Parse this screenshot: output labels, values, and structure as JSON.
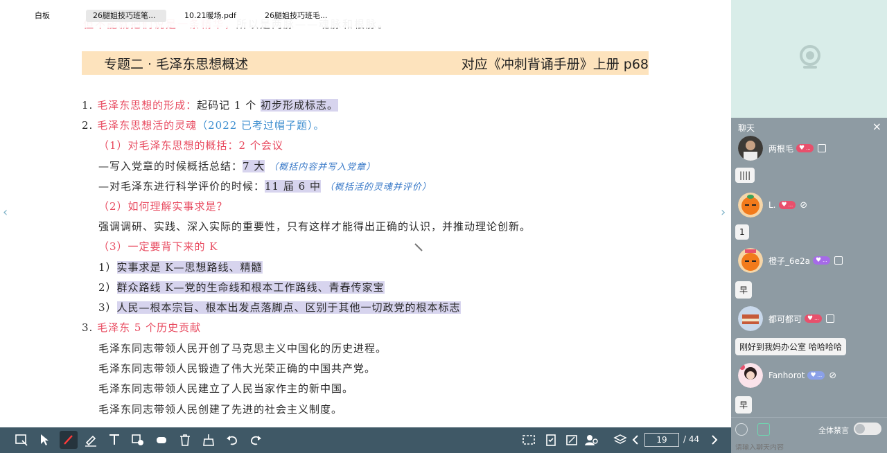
{
  "tabs": [
    "白板",
    "26腿姐技巧班笔...",
    "10.21暖场.pdf",
    "26腿姐技巧班毛..."
  ],
  "doc": {
    "top_fragment_red": "但不能就把们说是一条精华，",
    "top_fragment_rest": "所以是两脉——魂脉和根脉。",
    "banner_title": "专题二 · 毛泽东思想概述",
    "banner_ref": "对应《冲刺背诵手册》上册 p68",
    "items": {
      "l1_num": "1.",
      "l1_red": "毛泽东思想的形成：",
      "l1_text": "起码记 1 个",
      "l1_hl": "初步形成标志。",
      "l2_num": "2.",
      "l2_red": "毛泽东思想活的灵魂",
      "l2_blue": "（2022 已考过帽子题）。",
      "l3": "（1）对毛泽东思想的概括：2 个会议",
      "l4_text": "—写入党章的时候概括总结：",
      "l4_hl": "7 大",
      "l4_note": "（概括内容并写入党章）",
      "l5_text": "—对毛泽东进行科学评价的时候：",
      "l5_hl": "11 届 6 中",
      "l5_note": "（概括活的灵魂并评价）",
      "l6": "（2）如何理解实事求是？",
      "l7": "强调调研、实践、深入实际的重要性，只有这样才能得出正确的认识，并推动理论创新。",
      "l8": "（3）一定要背下来的 K",
      "l9_num": "1）",
      "l9_hl": "实事求是 K—思想路线、精髓",
      "l10_num": "2）",
      "l10_hl": "群众路线 K—党的生命线和根本工作路线、青春传家宝",
      "l11_num": "3）",
      "l11_hl": "人民—根本宗旨、根本出发点落脚点、区别于其他一切政党的根本标志",
      "l12_num": "3.",
      "l12_red": "毛泽东 5 个历史贡献",
      "l13": "毛泽东同志带领人民开创了马克思主义中国化的历史进程。",
      "l14": "毛泽东同志带领人民锻造了伟大光荣正确的中国共产党。",
      "l15": "毛泽东同志带领人民建立了人民当家作主的新中国。",
      "l16": "毛泽东同志带领人民创建了先进的社会主义制度。"
    }
  },
  "chat": {
    "header": "聊天",
    "close": "×",
    "messages": [
      {
        "user": "两根毛",
        "badge": "..."
      },
      {
        "bubble": "||||"
      },
      {
        "user": "L.",
        "badge": "..."
      },
      {
        "bubble": "1"
      },
      {
        "user": "橙子_6e2a",
        "badge": "..."
      },
      {
        "bubble": "早"
      },
      {
        "user": "都可都可",
        "badge": "..."
      },
      {
        "bubble": "刚好到我妈办公室 哈哈哈哈"
      },
      {
        "user": "Fanhorot",
        "badge": "..."
      },
      {
        "bubble": "早"
      }
    ],
    "mute_label": "全体禁言",
    "input_placeholder": "请输入聊天内容"
  },
  "toolbar": {
    "page_current": "19",
    "page_total": "/ 44"
  },
  "colors": {
    "toolbar_bg": "#3f5866",
    "chat_bg": "#8e9ba3",
    "banner_bg": "#fde3bd",
    "red_text": "#e84a5f",
    "highlight": "#d7d4ee"
  }
}
